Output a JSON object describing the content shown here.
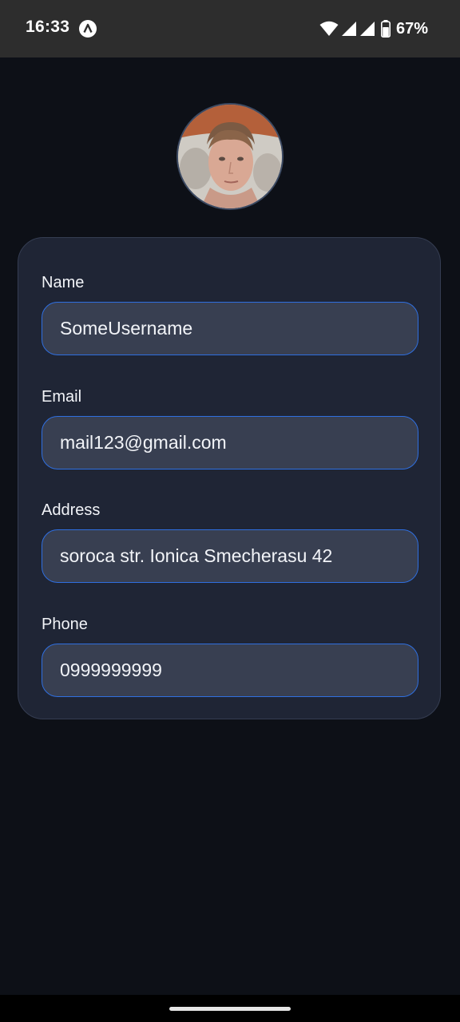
{
  "status_bar": {
    "time": "16:33",
    "battery_percent": "67%",
    "icons": [
      "app-notification-icon",
      "wifi-icon",
      "signal-icon",
      "signal-icon",
      "battery-icon"
    ]
  },
  "profile": {
    "avatar": "profile-photo"
  },
  "form": {
    "fields": [
      {
        "label": "Name",
        "value": "SomeUsername"
      },
      {
        "label": "Email",
        "value": "mail123@gmail.com"
      },
      {
        "label": "Address",
        "value": "soroca str. Ionica Smecherasu 42"
      },
      {
        "label": "Phone",
        "value": "0999999999"
      }
    ]
  },
  "colors": {
    "background": "#0d1017",
    "card": "#1f2535",
    "input": "#383f51",
    "input_border": "#2f6fe0",
    "status_bar": "#2d2d2d"
  }
}
